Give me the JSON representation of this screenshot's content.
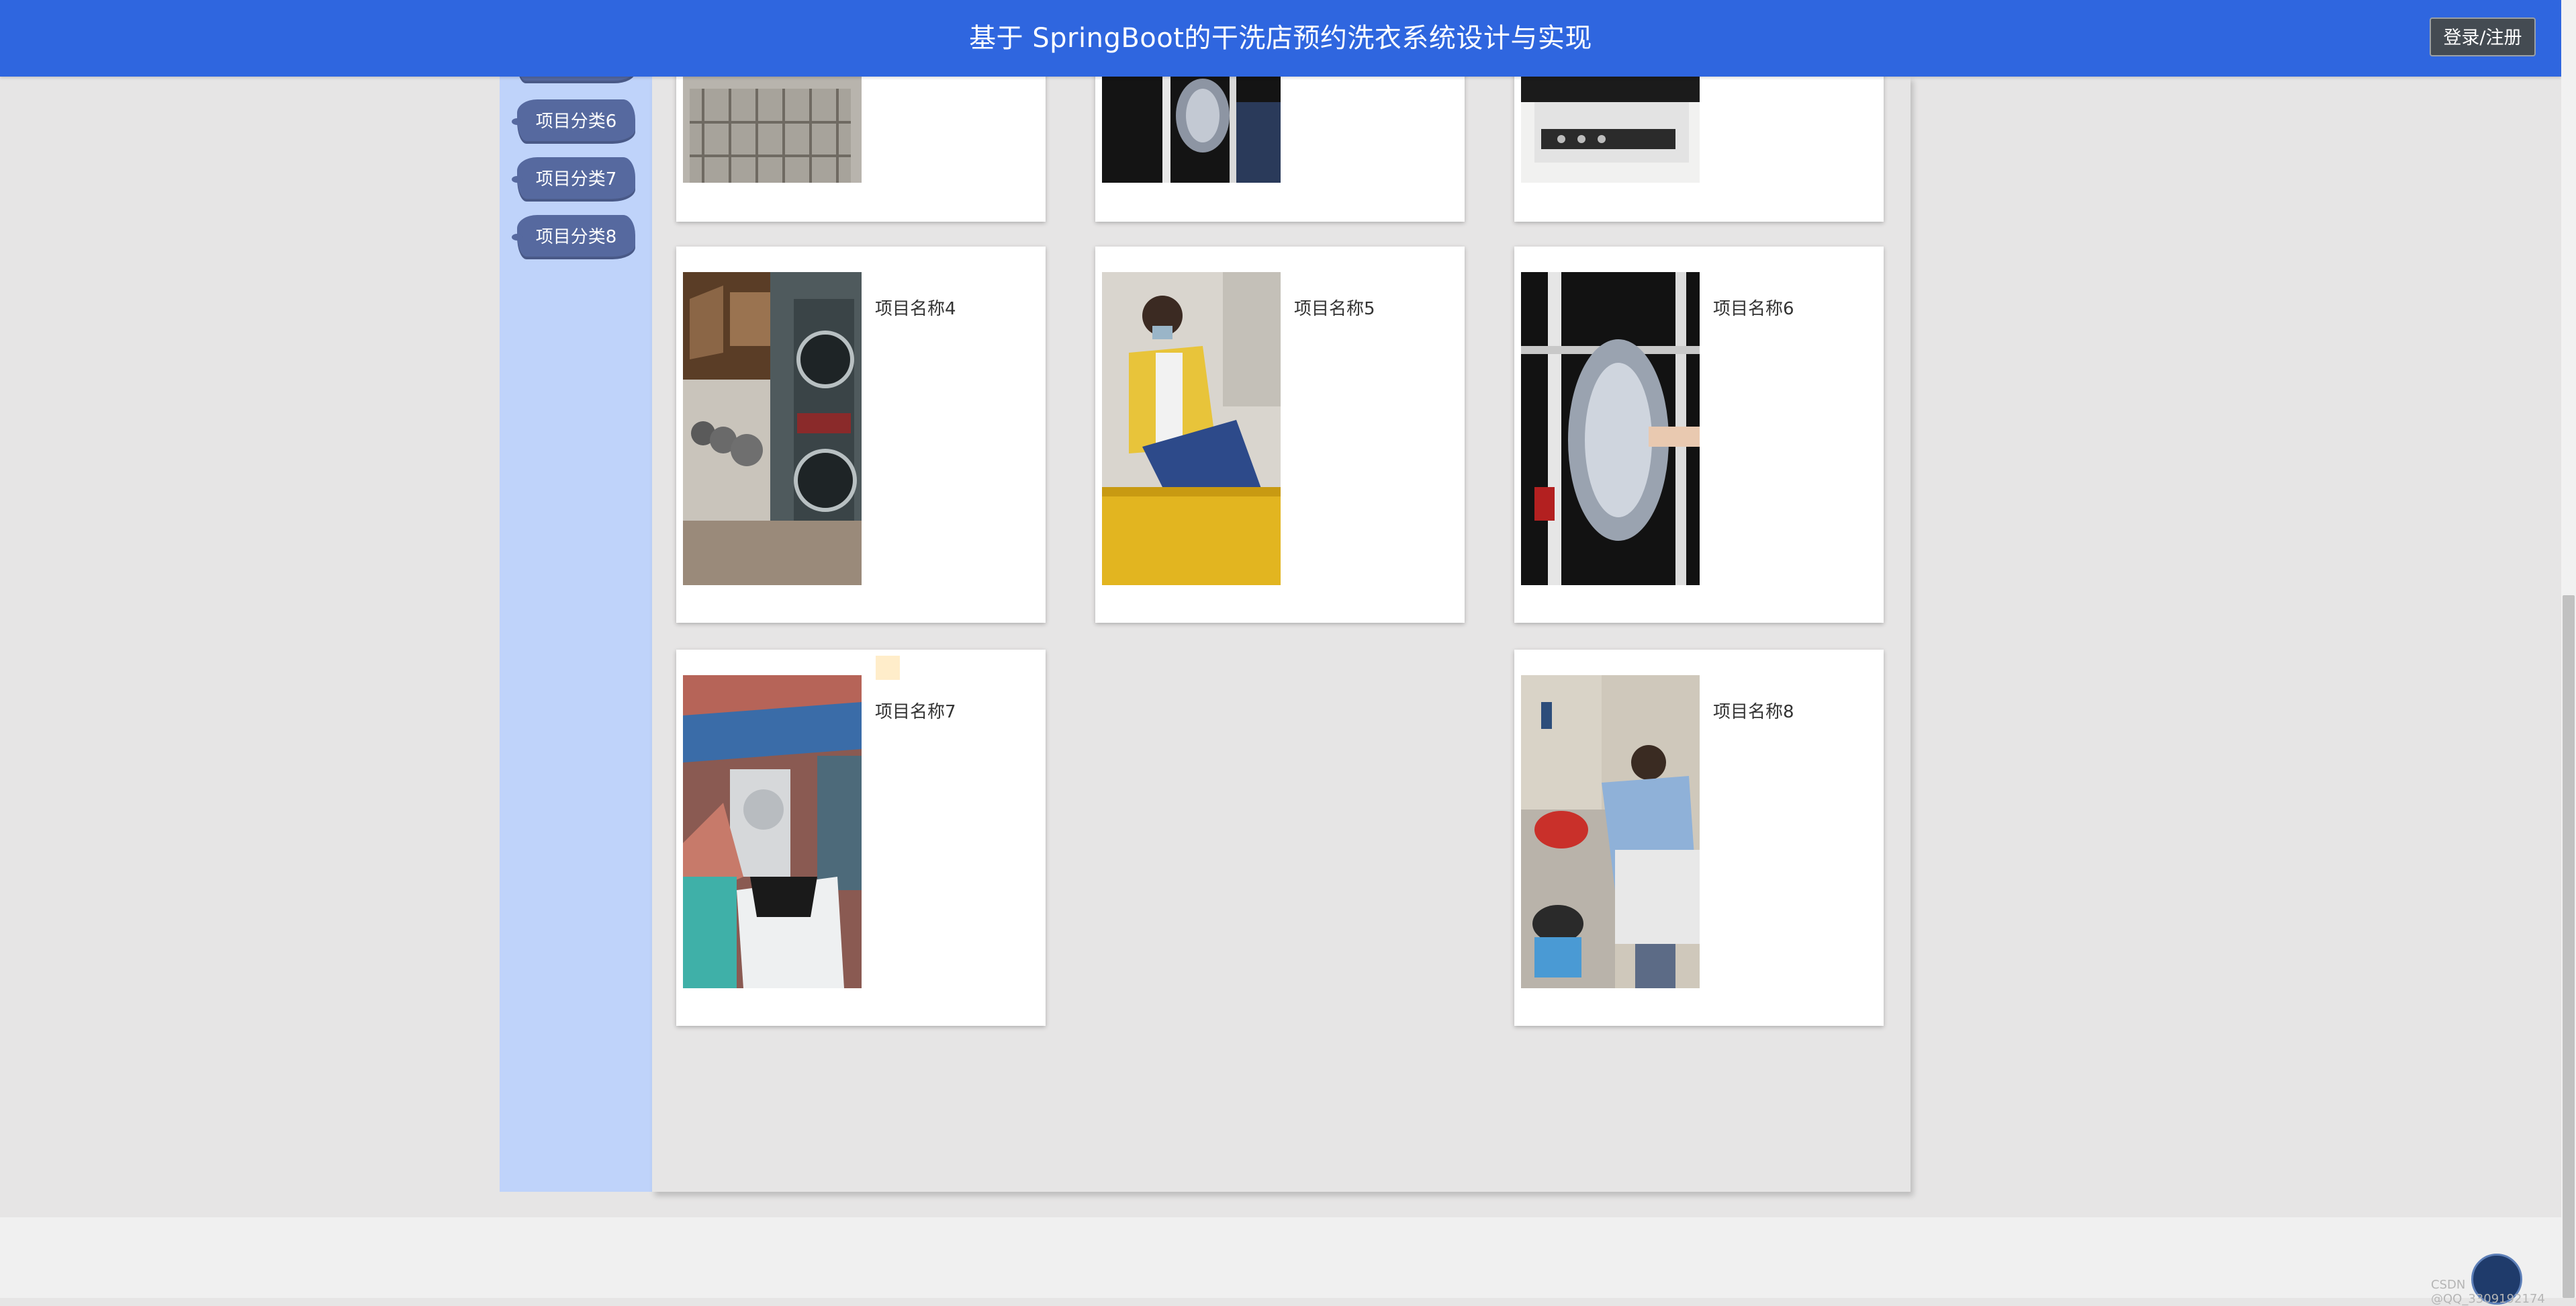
{
  "header": {
    "title": "基于 SpringBoot的干洗店预约洗衣系统设计与实现",
    "login_label": "登录/注册",
    "bar_color": "#2f66df"
  },
  "sidebar": {
    "items": [
      {
        "label": "项目分类6"
      },
      {
        "label": "项目分类7"
      },
      {
        "label": "项目分类8"
      }
    ]
  },
  "products": [
    {
      "name": "",
      "image": "laundry-cart-photo"
    },
    {
      "name": "",
      "image": "dry-cleaning-rack-photo"
    },
    {
      "name": "",
      "image": "washing-machine-photo"
    },
    {
      "name": "项目名称4",
      "image": "laundromat-machines-photo"
    },
    {
      "name": "项目名称5",
      "image": "worker-sorting-clothes-photo"
    },
    {
      "name": "项目名称6",
      "image": "garment-rack-photo"
    },
    {
      "name": "项目名称7",
      "image": "laundry-factory-photo"
    },
    {
      "name": "项目名称8",
      "image": "home-washing-photo"
    }
  ],
  "watermark": "CSDN @QQ_3309192174"
}
